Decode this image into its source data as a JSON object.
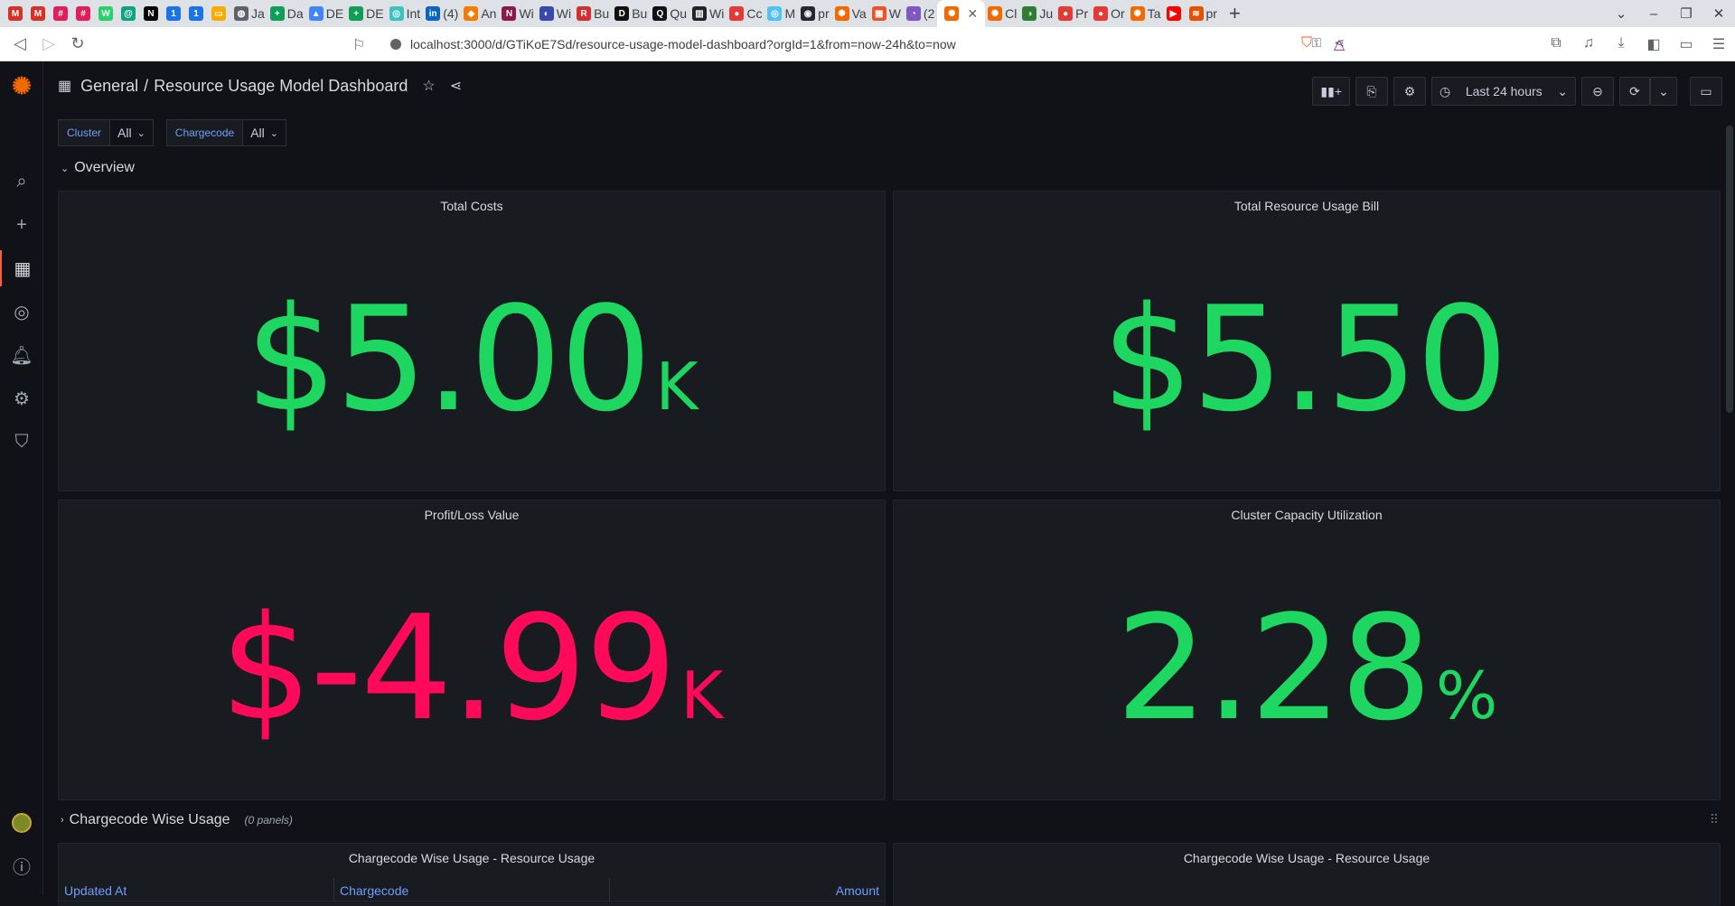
{
  "browser": {
    "tabs": [
      {
        "label": "",
        "color": "#d93025",
        "glyph": "M"
      },
      {
        "label": "",
        "color": "#d93025",
        "glyph": "M"
      },
      {
        "label": "",
        "color": "#e01e5a",
        "glyph": "#"
      },
      {
        "label": "",
        "color": "#e01e5a",
        "glyph": "#"
      },
      {
        "label": "",
        "color": "#25d366",
        "glyph": "W"
      },
      {
        "label": "",
        "color": "#10a37f",
        "glyph": "@"
      },
      {
        "label": "",
        "color": "#000000",
        "glyph": "N"
      },
      {
        "label": "",
        "color": "#1a73e8",
        "glyph": "1"
      },
      {
        "label": "",
        "color": "#1a73e8",
        "glyph": "1"
      },
      {
        "label": "",
        "color": "#f9ab00",
        "glyph": "▭"
      },
      {
        "label": "Ja",
        "color": "#5f6368",
        "glyph": "◍"
      },
      {
        "label": "Da",
        "color": "#0f9d58",
        "glyph": "+"
      },
      {
        "label": "DE",
        "color": "#4285f4",
        "glyph": "▲"
      },
      {
        "label": "DE",
        "color": "#0f9d58",
        "glyph": "+"
      },
      {
        "label": "Int",
        "color": "#3dc2c2",
        "glyph": "◎"
      },
      {
        "label": "(4)",
        "color": "#0a66c2",
        "glyph": "in"
      },
      {
        "label": "An",
        "color": "#f57c00",
        "glyph": "◆"
      },
      {
        "label": "Wi",
        "color": "#8b1a4a",
        "glyph": "N"
      },
      {
        "label": "Wi",
        "color": "#3949ab",
        "glyph": "◐"
      },
      {
        "label": "Bu",
        "color": "#d32f2f",
        "glyph": "R"
      },
      {
        "label": "Bu",
        "color": "#111111",
        "glyph": "D"
      },
      {
        "label": "Qu",
        "color": "#111111",
        "glyph": "Q"
      },
      {
        "label": "Wi",
        "color": "#222222",
        "glyph": "▥"
      },
      {
        "label": "Cc",
        "color": "#e53935",
        "glyph": "●"
      },
      {
        "label": "M",
        "color": "#4fc3f7",
        "glyph": "◎"
      },
      {
        "label": "pr",
        "color": "#24292f",
        "glyph": "◉"
      },
      {
        "label": "Va",
        "color": "#f46800",
        "glyph": "✺"
      },
      {
        "label": "W",
        "color": "#f25022",
        "glyph": "▦"
      },
      {
        "label": "(2",
        "color": "#7e57c2",
        "glyph": "◔"
      },
      {
        "label": "",
        "color": "#f46800",
        "glyph": "✺",
        "active": true
      },
      {
        "label": "Cl",
        "color": "#f46800",
        "glyph": "✺"
      },
      {
        "label": "Ju",
        "color": "#2e7d32",
        "glyph": "◑"
      },
      {
        "label": "Pr",
        "color": "#e53935",
        "glyph": "●"
      },
      {
        "label": "Or",
        "color": "#e53935",
        "glyph": "●"
      },
      {
        "label": "Ta",
        "color": "#f46800",
        "glyph": "✺"
      },
      {
        "label": "",
        "color": "#ff0000",
        "glyph": "▶"
      },
      {
        "label": "pr",
        "color": "#e65100",
        "glyph": "≋"
      }
    ],
    "url": "localhost:3000/d/GTiKoE7Sd/resource-usage-model-dashboard?orgId=1&from=now-24h&to=now"
  },
  "header": {
    "folder": "General",
    "separator": "/",
    "title": "Resource Usage Model Dashboard",
    "time_range": "Last 24 hours"
  },
  "variables": [
    {
      "label": "Cluster",
      "value": "All"
    },
    {
      "label": "Chargecode",
      "value": "All"
    }
  ],
  "rows": {
    "overview": {
      "title": "Overview"
    },
    "chargecode": {
      "title": "Chargecode Wise Usage",
      "count": "(0 panels)"
    }
  },
  "panels": {
    "total_costs": {
      "title": "Total Costs",
      "value": "$5.00",
      "unit": "K",
      "color": "#1ed760"
    },
    "total_bill": {
      "title": "Total Resource Usage Bill",
      "value": "$5.50",
      "unit": "",
      "color": "#1ed760"
    },
    "profit_loss": {
      "title": "Profit/Loss Value",
      "value": "$-4.99",
      "unit": "K",
      "color": "#ff0a5a"
    },
    "capacity": {
      "title": "Cluster Capacity Utilization",
      "value": "2.28",
      "unit": "%",
      "color": "#1ed760"
    },
    "usage_table": {
      "title": "Chargecode Wise Usage - Resource Usage",
      "columns": [
        "Updated At",
        "Chargecode",
        "Amount"
      ]
    },
    "usage_chart": {
      "title": "Chargecode Wise Usage - Resource Usage"
    }
  }
}
